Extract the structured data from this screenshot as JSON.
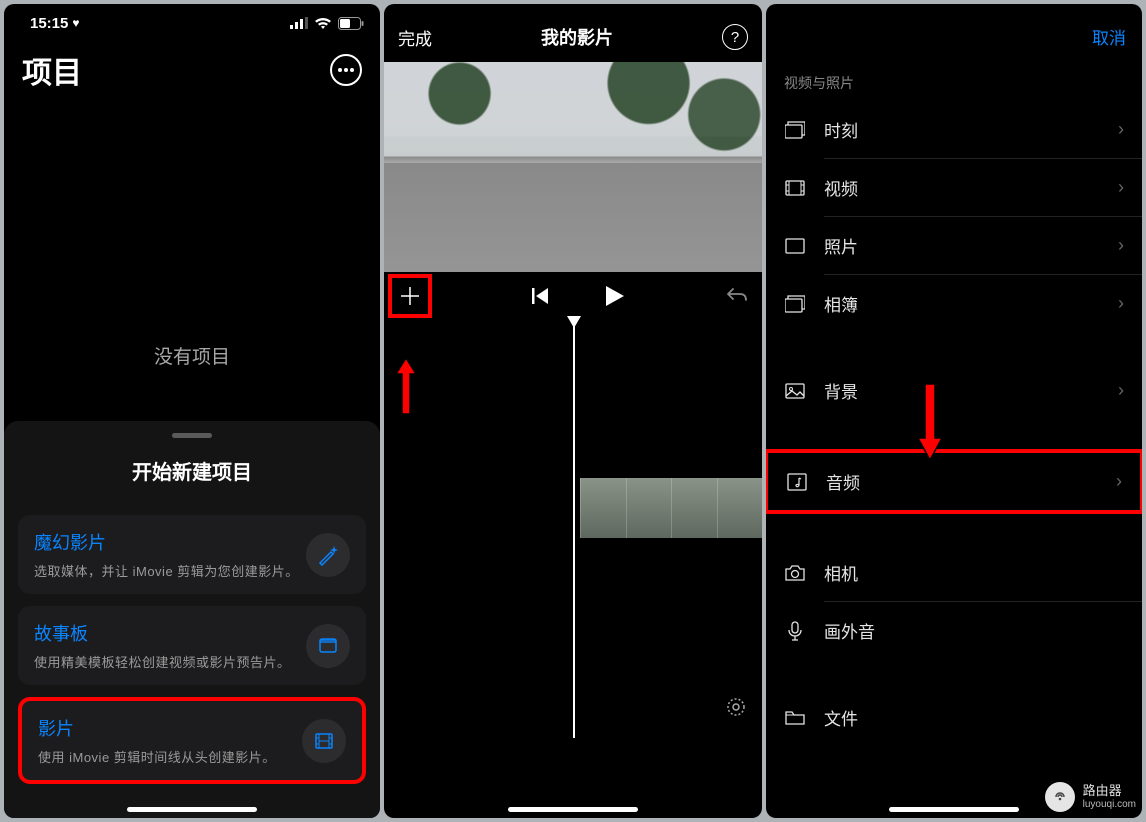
{
  "pane1": {
    "status": {
      "time": "15:15",
      "heart": "♥"
    },
    "title": "项目",
    "empty": "没有项目",
    "sheet_title": "开始新建项目",
    "cards": [
      {
        "title": "魔幻影片",
        "sub": "选取媒体，并让 iMovie 剪辑为您创建影片。",
        "icon": "wand"
      },
      {
        "title": "故事板",
        "sub": "使用精美模板轻松创建视频或影片预告片。",
        "icon": "storyboard"
      },
      {
        "title": "影片",
        "sub": "使用 iMovie 剪辑时间线从头创建影片。",
        "icon": "film"
      }
    ]
  },
  "pane2": {
    "done": "完成",
    "title": "我的影片"
  },
  "pane3": {
    "cancel": "取消",
    "section1": "视频与照片",
    "items": [
      {
        "label": "时刻",
        "icon": "moments"
      },
      {
        "label": "视频",
        "icon": "video"
      },
      {
        "label": "照片",
        "icon": "photo"
      },
      {
        "label": "相簿",
        "icon": "album"
      }
    ],
    "bg": {
      "label": "背景",
      "icon": "image"
    },
    "audio": {
      "label": "音频",
      "icon": "audio"
    },
    "camera": {
      "label": "相机",
      "icon": "camera"
    },
    "voiceover": {
      "label": "画外音",
      "icon": "mic"
    },
    "files": {
      "label": "文件",
      "icon": "folder"
    }
  },
  "watermark": {
    "name": "路由器",
    "url": "luyouqi.com"
  }
}
